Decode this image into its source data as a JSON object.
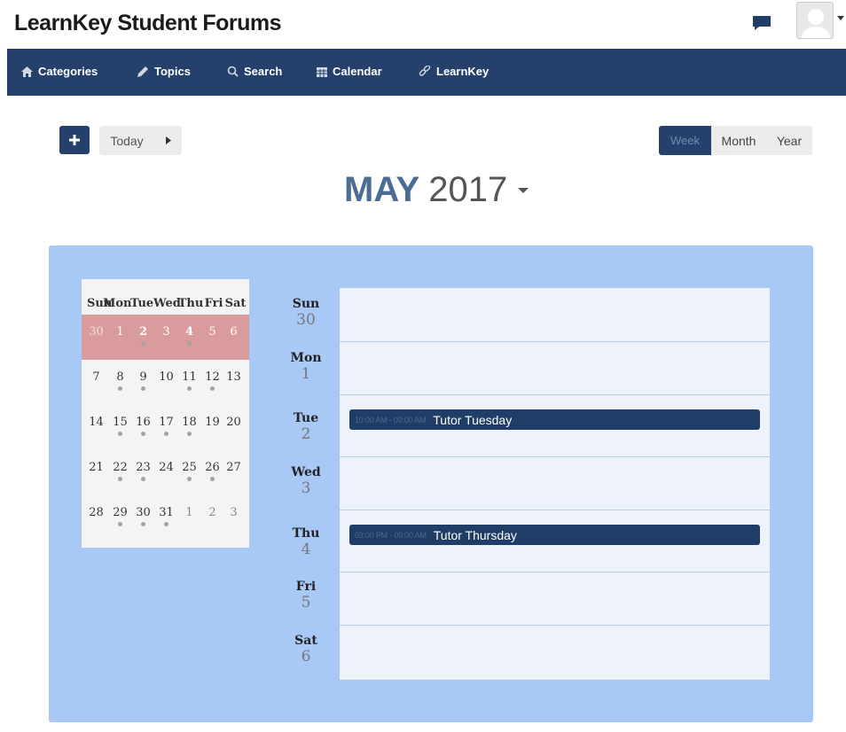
{
  "header": {
    "site_title": "LearnKey Student Forums",
    "icons": {
      "chat": "chat-bubble-icon",
      "avatar": "user-avatar"
    }
  },
  "nav": {
    "items": [
      {
        "label": "Categories",
        "icon": "home-icon"
      },
      {
        "label": "Topics",
        "icon": "pencil-icon"
      },
      {
        "label": "Search",
        "icon": "search-icon"
      },
      {
        "label": "Calendar",
        "icon": "calendar-icon"
      },
      {
        "label": "LearnKey",
        "icon": "link-icon"
      }
    ]
  },
  "toolbar": {
    "add_icon": "plus-icon",
    "today_label": "Today",
    "next_icon": "play-right-icon",
    "views": [
      "Week",
      "Month",
      "Year"
    ],
    "active_view": "Week"
  },
  "title": {
    "month": "MAY",
    "year": "2017"
  },
  "mini_calendar": {
    "weekdays": [
      "Sun",
      "Mon",
      "Tue",
      "Wed",
      "Thu",
      "Fri",
      "Sat"
    ],
    "weeks": [
      [
        {
          "d": "30",
          "other": true
        },
        {
          "d": "1"
        },
        {
          "d": "2",
          "bold": true,
          "dot": true
        },
        {
          "d": "3"
        },
        {
          "d": "4",
          "bold": true,
          "dot": true
        },
        {
          "d": "5"
        },
        {
          "d": "6"
        }
      ],
      [
        {
          "d": "7"
        },
        {
          "d": "8",
          "dot": true
        },
        {
          "d": "9",
          "dot": true
        },
        {
          "d": "10"
        },
        {
          "d": "11",
          "dot": true
        },
        {
          "d": "12",
          "dot": true
        },
        {
          "d": "13"
        }
      ],
      [
        {
          "d": "14"
        },
        {
          "d": "15",
          "dot": true
        },
        {
          "d": "16",
          "dot": true
        },
        {
          "d": "17",
          "dot": true
        },
        {
          "d": "18",
          "dot": true
        },
        {
          "d": "19"
        },
        {
          "d": "20"
        }
      ],
      [
        {
          "d": "21"
        },
        {
          "d": "22",
          "dot": true
        },
        {
          "d": "23",
          "dot": true
        },
        {
          "d": "24"
        },
        {
          "d": "25",
          "dot": true
        },
        {
          "d": "26",
          "dot": true
        },
        {
          "d": "27"
        }
      ],
      [
        {
          "d": "28"
        },
        {
          "d": "29",
          "dot": true
        },
        {
          "d": "30",
          "dot": true
        },
        {
          "d": "31",
          "dot": true
        },
        {
          "d": "1",
          "other": true
        },
        {
          "d": "2",
          "other": true
        },
        {
          "d": "3",
          "other": true
        }
      ]
    ]
  },
  "week_days": [
    {
      "name": "Sun",
      "num": "30"
    },
    {
      "name": "Mon",
      "num": "1"
    },
    {
      "name": "Tue",
      "num": "2"
    },
    {
      "name": "Wed",
      "num": "3"
    },
    {
      "name": "Thu",
      "num": "4"
    },
    {
      "name": "Fri",
      "num": "5"
    },
    {
      "name": "Sat",
      "num": "6"
    }
  ],
  "events": [
    {
      "time": "10:00 AM - 09:00 AM",
      "title": "Tutor Tuesday",
      "day": "Tue"
    },
    {
      "time": "03:00 PM - 09:00 AM",
      "title": "Tutor Thursday",
      "day": "Thu"
    }
  ],
  "colors": {
    "navbar": "#25406a",
    "panel": "#a8c8f5",
    "current_week_highlight": "#d99b9b",
    "event": "#1f3d66"
  }
}
